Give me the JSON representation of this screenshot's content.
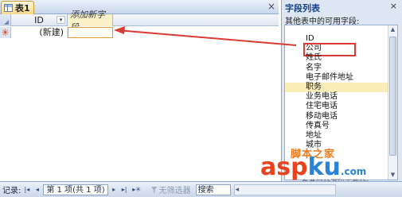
{
  "document": {
    "tab_label": "表1",
    "close_glyph": "×"
  },
  "grid": {
    "columns": [
      "ID",
      "添加新字段"
    ],
    "column_dropdown_glyph": "▾",
    "new_row_marker": "✳",
    "new_row_value": "(新建)"
  },
  "field_list": {
    "title": "字段列表",
    "close_glyph": "×",
    "subtitle": "其他表中的可用字段:",
    "fields": [
      "ID",
      "公司",
      "姓氏",
      "名字",
      "电子邮件地址",
      "职务",
      "业务电话",
      "住宅电话",
      "移动电话",
      "传真号",
      "地址",
      "城市"
    ],
    "highlighted_field": "职务",
    "boxed_field": "公司"
  },
  "status_bar": {
    "record_label": "记录:",
    "nav_first": "|◂",
    "nav_prev": "◂",
    "record_position": "第 1 项(共 1 项)",
    "nav_next": "▸",
    "nav_last": "▸|",
    "nav_new": "▸✳",
    "filter_label": "无筛选器",
    "search_label": "搜索"
  },
  "watermark": {
    "top_text": "脚本之家",
    "brand_left": "asp",
    "brand_right": "ku",
    "brand_suffix": ".com",
    "tagline": "免费网站源码下载站!"
  },
  "colors": {
    "accent_arrow": "#d93a33",
    "highlight_row": "#fbeeb8",
    "header_blue": "#15428b"
  }
}
